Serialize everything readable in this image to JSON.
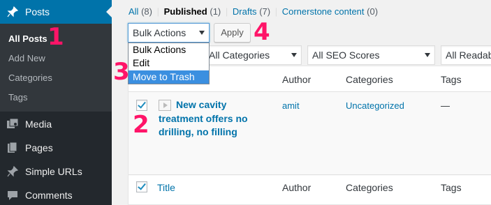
{
  "sidebar": {
    "posts_label": "Posts",
    "submenu": [
      "All Posts",
      "Add New",
      "Categories",
      "Tags"
    ],
    "items": [
      {
        "label": "Media",
        "icon": "media-icon"
      },
      {
        "label": "Pages",
        "icon": "pages-icon"
      },
      {
        "label": "Simple URLs",
        "icon": "pin-icon"
      },
      {
        "label": "Comments",
        "icon": "comment-icon"
      }
    ]
  },
  "status_links": {
    "all": "All",
    "all_count": "(8)",
    "published": "Published",
    "published_count": "(1)",
    "drafts": "Drafts",
    "drafts_count": "(7)",
    "cornerstone": "Cornerstone content",
    "cornerstone_count": "(0)",
    "separator": "|"
  },
  "toolbar": {
    "bulk_selected": "Bulk Actions",
    "apply_label": "Apply",
    "bulk_options": [
      "Bulk Actions",
      "Edit",
      "Move to Trash"
    ],
    "highlighted_option": "Move to Trash",
    "categories_filter": "All Categories",
    "seo_filter": "All SEO Scores",
    "readability_filter": "All Readab"
  },
  "table": {
    "columns": [
      "Title",
      "Author",
      "Categories",
      "Tags"
    ],
    "row": {
      "title": "New cavity treatment offers no drilling, no filling",
      "author": "amit",
      "categories": "Uncategorized",
      "tags": "—",
      "checked": true
    },
    "header_checked": true
  },
  "annotations": [
    "1",
    "2",
    "3",
    "4"
  ],
  "colors": {
    "accent": "#0073aa",
    "sidebar": "#23282d",
    "annotation": "#ff1468"
  }
}
